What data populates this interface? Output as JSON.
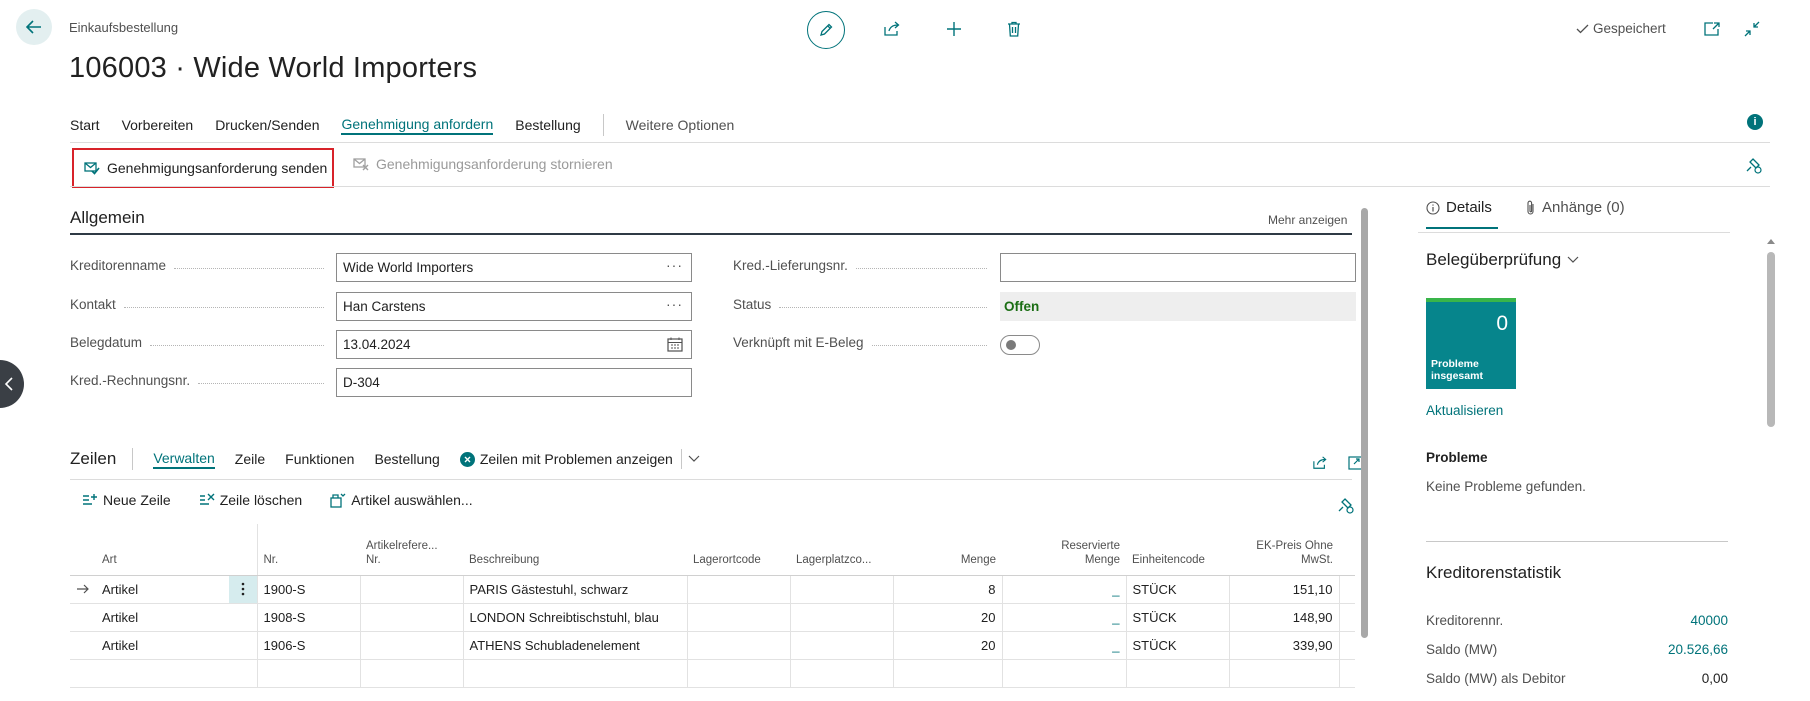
{
  "header": {
    "breadcrumb": "Einkaufsbestellung",
    "title": "106003 · Wide World Importers",
    "saved_label": "Gespeichert"
  },
  "menu": {
    "items": [
      "Start",
      "Vorbereiten",
      "Drucken/Senden",
      "Genehmigung anfordern",
      "Bestellung"
    ],
    "more": "Weitere Optionen",
    "active_index": 3
  },
  "actions": {
    "send_request": "Genehmigungsanforderung senden",
    "cancel_request": "Genehmigungsanforderung stornieren"
  },
  "general": {
    "title": "Allgemein",
    "show_more": "Mehr anzeigen",
    "fields": {
      "vendor_name_label": "Kreditorenname",
      "vendor_name_value": "Wide World Importers",
      "contact_label": "Kontakt",
      "contact_value": "Han Carstens",
      "doc_date_label": "Belegdatum",
      "doc_date_value": "13.04.2024",
      "invoice_no_label": "Kred.-Rechnungsnr.",
      "invoice_no_value": "D-304",
      "shipment_no_label": "Kred.-Lieferungsnr.",
      "shipment_no_value": "",
      "status_label": "Status",
      "status_value": "Offen",
      "linked_label": "Verknüpft mit E-Beleg"
    }
  },
  "lines": {
    "title": "Zeilen",
    "tabs": [
      "Verwalten",
      "Zeile",
      "Funktionen",
      "Bestellung"
    ],
    "problems_button": "Zeilen mit Problemen anzeigen",
    "sub_actions": [
      "Neue Zeile",
      "Zeile löschen",
      "Artikel auswählen..."
    ],
    "columns": {
      "art": "Art",
      "nr": "Nr.",
      "ref_1": "Artikelrefere...",
      "ref_2": "Nr.",
      "desc": "Beschreibung",
      "location": "Lagerortcode",
      "bin": "Lagerplatzco...",
      "qty": "Menge",
      "reserved_1": "Reservierte",
      "reserved_2": "Menge",
      "unit": "Einheitencode",
      "price_1": "EK-Preis Ohne",
      "price_2": "MwSt."
    },
    "rows": [
      {
        "art": "Artikel",
        "nr": "1900-S",
        "desc": "PARIS Gästestuhl, schwarz",
        "qty": "8",
        "reserved": "_",
        "unit": "STÜCK",
        "price": "151,10"
      },
      {
        "art": "Artikel",
        "nr": "1908-S",
        "desc": "LONDON Schreibtischstuhl, blau",
        "qty": "20",
        "reserved": "_",
        "unit": "STÜCK",
        "price": "148,90"
      },
      {
        "art": "Artikel",
        "nr": "1906-S",
        "desc": "ATHENS Schubladenelement",
        "qty": "20",
        "reserved": "_",
        "unit": "STÜCK",
        "price": "339,90"
      }
    ]
  },
  "factbox": {
    "tab_details": "Details",
    "tab_attachments": "Anhänge (0)",
    "review_title": "Belegüberprüfung",
    "tile_value": "0",
    "tile_label_1": "Probleme",
    "tile_label_2": "insgesamt",
    "refresh": "Aktualisieren",
    "problems_title": "Probleme",
    "problems_text": "Keine Probleme gefunden.",
    "stats_title": "Kreditorenstatistik",
    "stats": [
      {
        "label": "Kreditorennr.",
        "value": "40000"
      },
      {
        "label": "Saldo (MW)",
        "value": "20.526,66"
      },
      {
        "label": "Saldo (MW) als Debitor",
        "value": "0,00"
      }
    ]
  },
  "colors": {
    "accent": "#00737a",
    "highlight_border": "#d8232a",
    "tile": "#06858c",
    "status_text": "#1b6e14"
  }
}
